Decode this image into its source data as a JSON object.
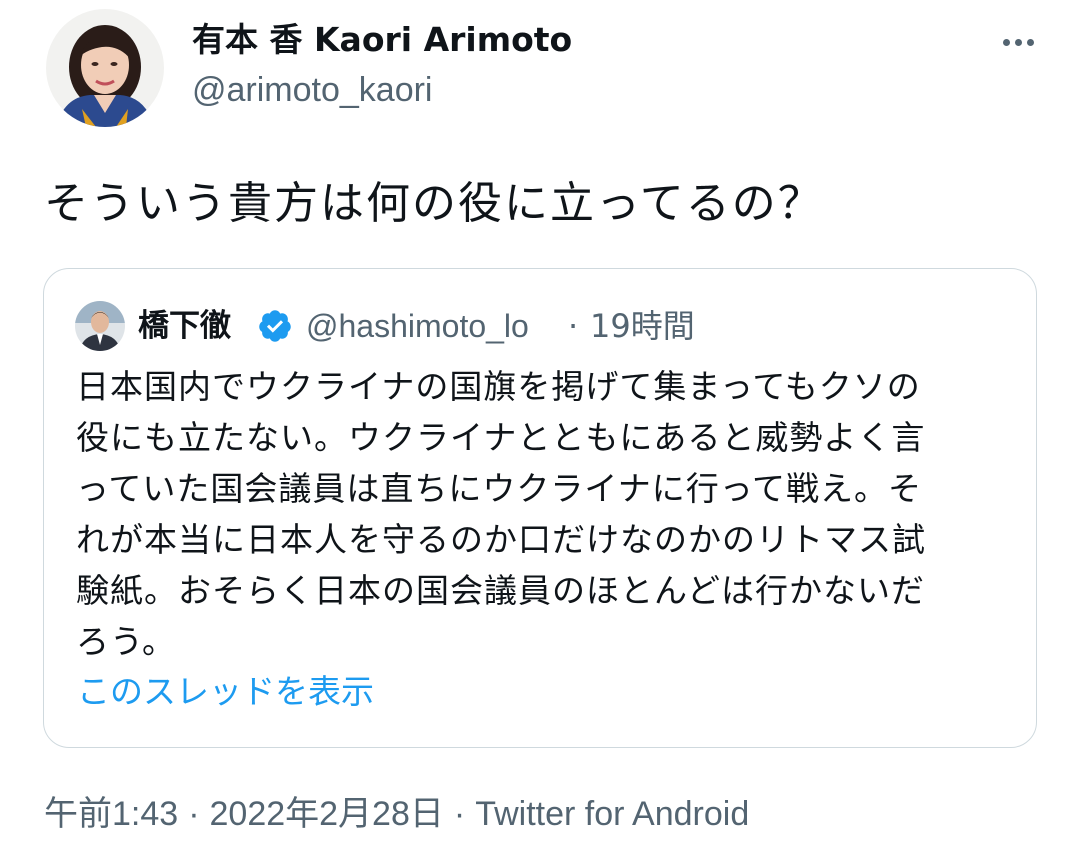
{
  "author": {
    "display_name": "有本 香 Kaori Arimoto",
    "handle": "@arimoto_kaori",
    "avatar_icon": "profile-photo"
  },
  "more_icon": "more-horizontal-icon",
  "tweet": {
    "text": "そういう貴方は何の役に立ってるの？"
  },
  "quoted_tweet": {
    "display_name": "橋下徹",
    "verified_icon": "verified-badge-icon",
    "handle": "@hashimoto_lo",
    "separator": "·",
    "time_ago": "19時間",
    "body_lines": [
      "日本国内でウクライナの国旗を掲げて集まってもクソの",
      "役にも立たない。ウクライナとともにあると威勢よく言",
      "っていた国会議員は直ちにウクライナに行って戦え。そ",
      "れが本当に日本人を守るのか口だけなのかのリトマス試",
      "験紙。おそらく日本の国会議員のほとんどは行かないだ",
      "ろう。"
    ],
    "show_thread_label": "このスレッドを表示"
  },
  "meta": {
    "time": "午前1:43",
    "sep1": "·",
    "date": "2022年2月28日",
    "sep2": "·",
    "source": "Twitter for Android"
  },
  "colors": {
    "text_primary": "#0f1419",
    "text_secondary": "#536471",
    "link": "#1d9bf0",
    "border": "#cfd9de",
    "verified": "#1d9bf0"
  }
}
